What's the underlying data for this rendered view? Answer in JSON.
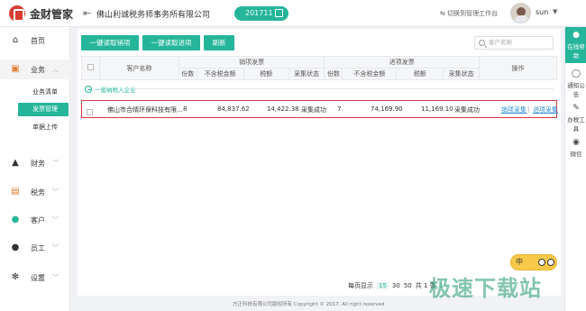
{
  "app": {
    "title": "金财管家"
  },
  "header": {
    "company": "佛山利诚税务师事务所有限公司",
    "period": "201711",
    "switch_label": "切换到管理工作台",
    "username": "sun"
  },
  "sidebar": {
    "items": [
      {
        "label": "首页"
      },
      {
        "label": "业务",
        "expanded": true,
        "children": [
          {
            "label": "业务清单"
          },
          {
            "label": "发票管理",
            "active": true
          },
          {
            "label": "单据上传"
          }
        ]
      },
      {
        "label": "财务"
      },
      {
        "label": "税务"
      },
      {
        "label": "客户"
      },
      {
        "label": "员工"
      },
      {
        "label": "设置"
      }
    ]
  },
  "toolbar": {
    "btn_sales": "一键读取销项",
    "btn_input": "一键读取进项",
    "btn_refresh": "刷新",
    "search_placeholder": "客户名称"
  },
  "table": {
    "col_customer": "客户名称",
    "group_sales": "销项发票",
    "group_input": "进项发票",
    "col_ops": "操作",
    "sub_count": "份数",
    "sub_amount": "不含税金额",
    "sub_tax": "税额",
    "sub_status": "采集状态",
    "group_label": "一般纳税人企业",
    "rows": [
      {
        "customer": "佛山市合晴环保科技有限...",
        "sales_count": "8",
        "sales_amount": "84,837.62",
        "sales_tax": "14,422.38",
        "sales_status": "采集成功",
        "input_count": "7",
        "input_amount": "74,169.90",
        "input_tax": "11,169.10",
        "input_status": "采集成功",
        "op_sales": "销项采集",
        "op_input": "进项采集"
      }
    ]
  },
  "pager": {
    "prefix": "每页显示",
    "size_15": "15",
    "size_30": "30",
    "size_50": "50",
    "total": "共 1 条",
    "page": "1"
  },
  "footer": {
    "text": "方正科技有限公司版权所有    Copyright  ©  2017. All right reserved"
  },
  "rail": {
    "items": [
      {
        "label": "在线帮助",
        "active": true
      },
      {
        "label": "通知公告"
      },
      {
        "label": "办税工具"
      },
      {
        "label": "微信"
      }
    ]
  },
  "widget": {
    "label": "中"
  },
  "watermark": {
    "text": "极速下载站"
  },
  "colors": {
    "accent": "#25b59a",
    "brand": "#d73d33",
    "highlight": "#d9363e",
    "link": "#2b8ccf"
  }
}
